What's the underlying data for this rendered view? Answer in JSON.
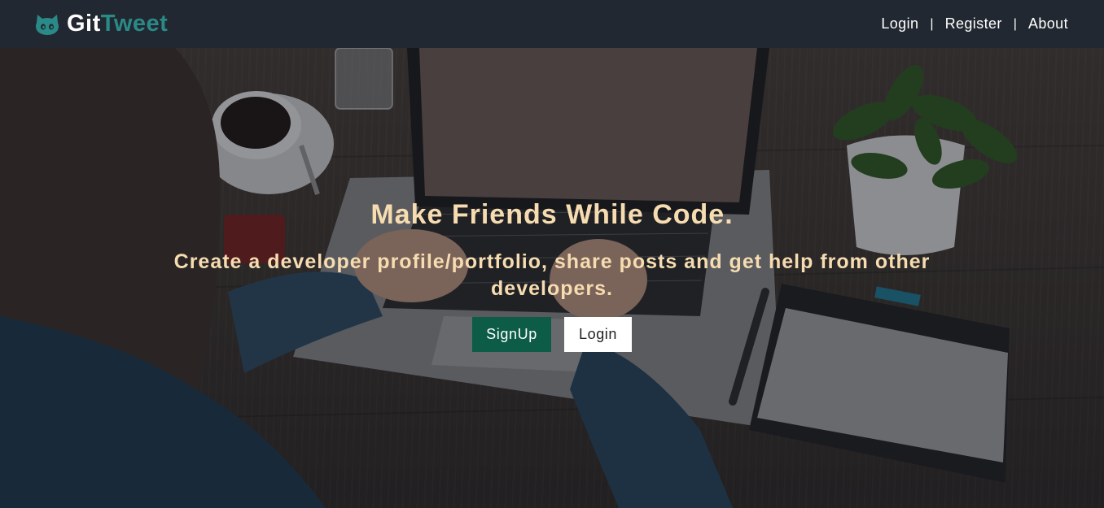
{
  "navbar": {
    "brand": {
      "part1": "Git",
      "part2": "Tweet",
      "icon": "github-octocat-icon"
    },
    "links": [
      {
        "label": "Login"
      },
      {
        "label": "Register"
      },
      {
        "label": "About"
      }
    ],
    "separator": "|"
  },
  "hero": {
    "title": "Make Friends While Code.",
    "subtitle": "Create a developer profile/portfolio, share posts and get help from other developers.",
    "buttons": {
      "signup_label": "SignUp",
      "login_label": "Login"
    },
    "background": "photo of a developer typing on a laptop at a wooden desk with coffee, water glass, plant, pen and tablet"
  },
  "colors": {
    "navbar_bg": "#222831",
    "brand_accent": "#2a8a87",
    "hero_text": "#f6dcb0",
    "signup_bg": "#0c5c48",
    "login_bg": "#ffffff"
  }
}
